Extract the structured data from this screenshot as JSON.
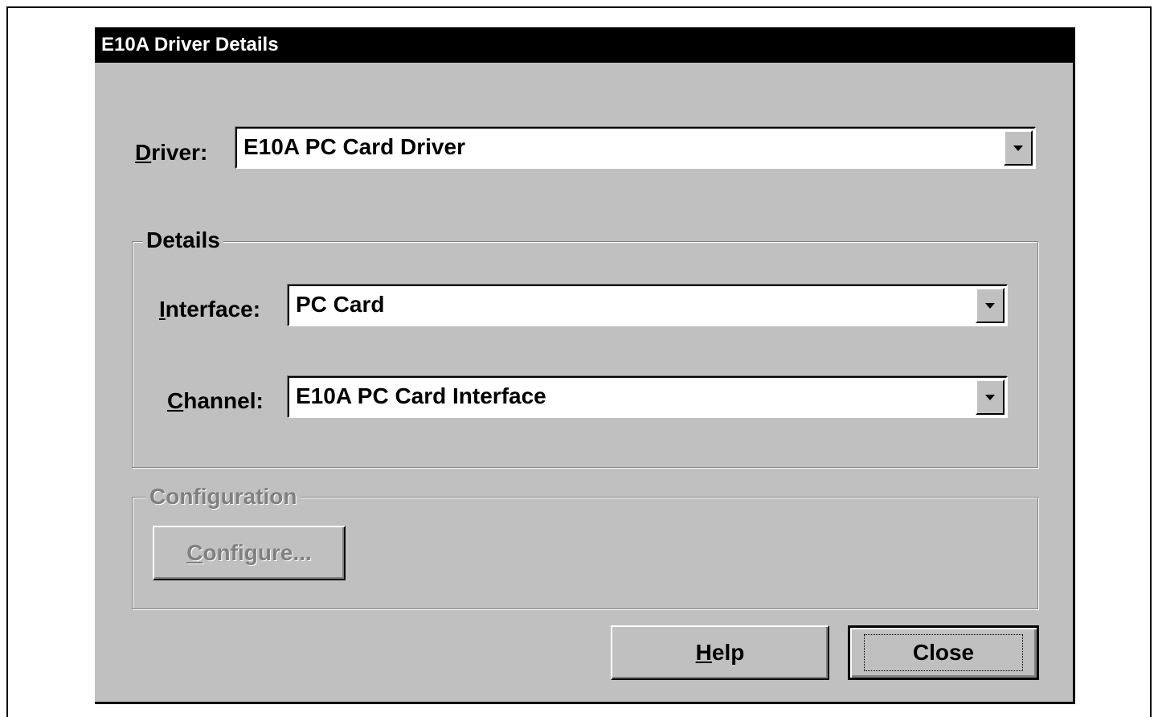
{
  "window": {
    "title": "E10A Driver Details"
  },
  "driver": {
    "label_accel": "D",
    "label_rest": "river:",
    "value": "E10A PC Card Driver"
  },
  "details": {
    "legend": "Details",
    "interface": {
      "label_accel": "I",
      "label_rest": "nterface:",
      "value": "PC Card"
    },
    "channel": {
      "label_accel": "C",
      "label_rest": "hannel:",
      "value": "E10A PC Card Interface"
    }
  },
  "configuration": {
    "legend": "Configuration",
    "configure_accel": "C",
    "configure_rest": "onfigure..."
  },
  "buttons": {
    "help_accel": "H",
    "help_rest": "elp",
    "close": "Close"
  },
  "icons": {
    "dropdown": "chevron-down-icon"
  }
}
